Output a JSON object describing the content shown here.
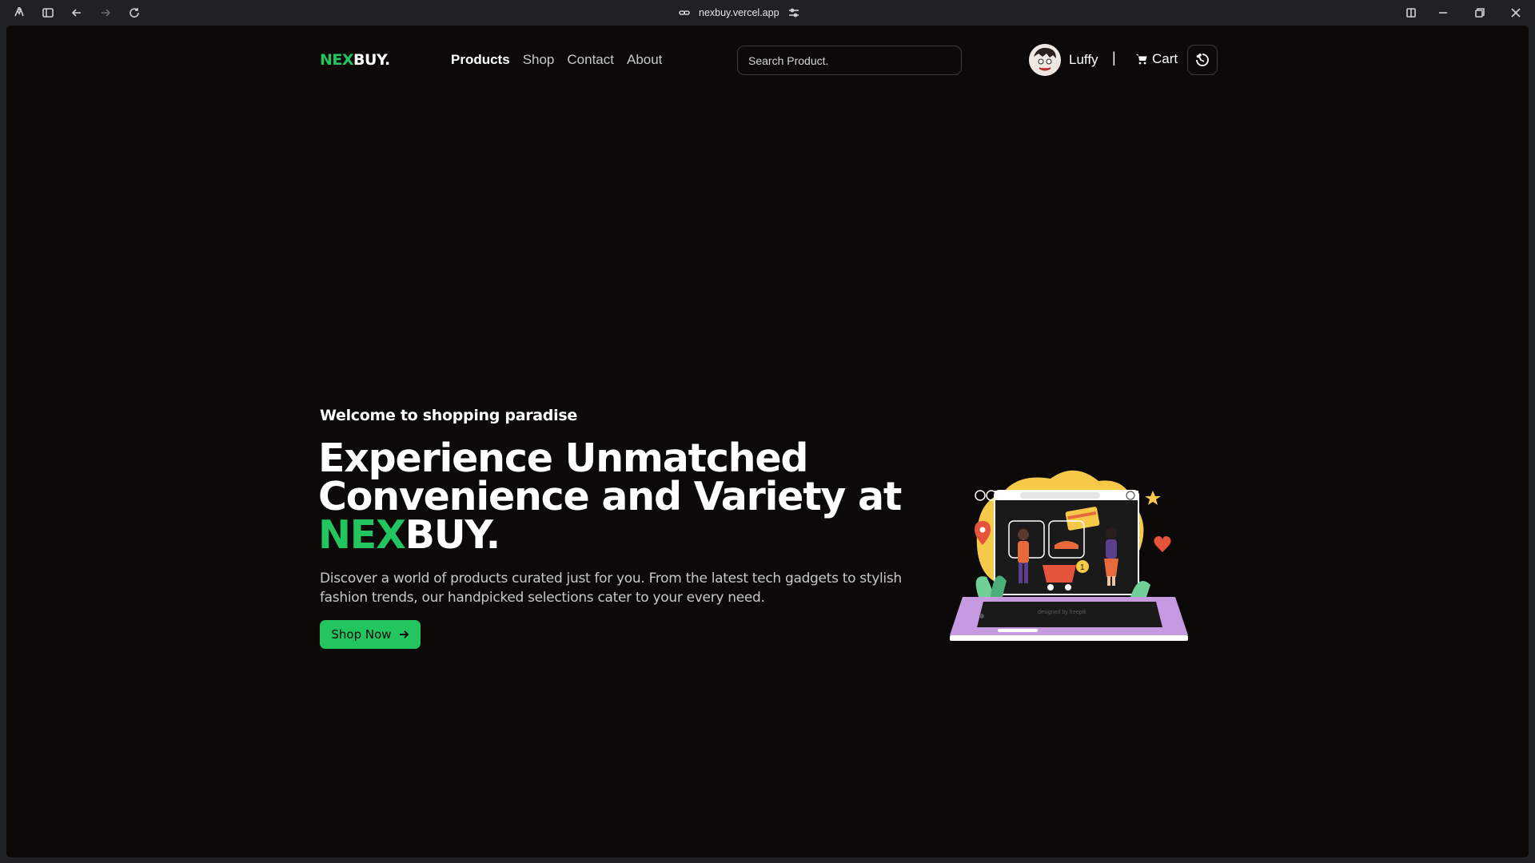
{
  "browser": {
    "url": "nexbuy.vercel.app",
    "icons": [
      "extensions-icon",
      "sidebar-icon",
      "back-icon",
      "forward-icon",
      "reload-icon",
      "link-icon",
      "tune-icon",
      "split-view-icon",
      "minimize-icon",
      "restore-icon",
      "close-icon"
    ]
  },
  "nav": {
    "logo_green": "NEX",
    "logo_white": "BUY.",
    "links": [
      {
        "label": "Products",
        "active": true
      },
      {
        "label": "Shop"
      },
      {
        "label": "Contact"
      },
      {
        "label": "About"
      }
    ],
    "search_placeholder": "Search Product.",
    "user_name": "Luffy",
    "separator": "|",
    "cart_label": "Cart"
  },
  "hero": {
    "welcome": "Welcome to shopping paradise",
    "headline": "Experience Unmatched Convenience and Variety at",
    "brand_green": "NEX",
    "brand_white": "BUY.",
    "description": "Discover a world of products curated just for you. From the latest tech gadgets to stylish fashion trends, our handpicked selections cater to your every need.",
    "cta_label": "Shop Now",
    "credit": "designed by freepik"
  },
  "colors": {
    "accent": "#22c55e",
    "background": "#0c0a09",
    "chrome": "#202124"
  }
}
